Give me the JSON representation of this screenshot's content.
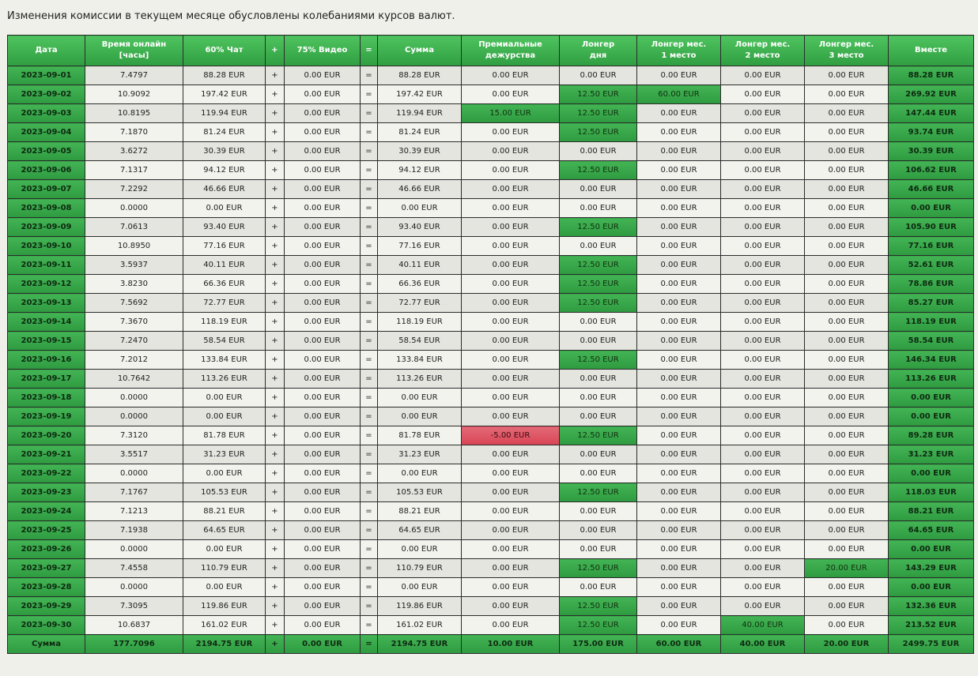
{
  "notice": "Изменения комиссии в текущем месяце обусловлены колебаниями курсов валют.",
  "colors": {
    "header_green": "#3bb34c",
    "cell_green": "#2f9e41",
    "cell_red": "#d94455",
    "row_light": "#f3f3ee",
    "row_dark": "#e4e5df"
  },
  "headers": {
    "date": "Дата",
    "hours_line1": "Время онлайн",
    "hours_line2": "[часы]",
    "chat": "60% Чат",
    "plus": "+",
    "video": "75% Видео",
    "equals": "=",
    "sum": "Сумма",
    "premium_line1": "Премиальные",
    "premium_line2": "дежурства",
    "longer_day_line1": "Лонгер",
    "longer_day_line2": "дня",
    "longer_m1_line1": "Лонгер мес.",
    "longer_m1_line2": "1 место",
    "longer_m2_line1": "Лонгер мес.",
    "longer_m2_line2": "2 место",
    "longer_m3_line1": "Лонгер мес.",
    "longer_m3_line2": "3 место",
    "total": "Вместе"
  },
  "rows": [
    {
      "date": "2023-09-01",
      "hours": "7.4797",
      "chat": "88.28 EUR",
      "plus": "+",
      "video": "0.00 EUR",
      "eq": "=",
      "sum": "88.28 EUR",
      "premium": "0.00 EUR",
      "longer_day": "0.00 EUR",
      "m1": "0.00 EUR",
      "m2": "0.00 EUR",
      "m3": "0.00 EUR",
      "total": "88.28 EUR"
    },
    {
      "date": "2023-09-02",
      "hours": "10.9092",
      "chat": "197.42 EUR",
      "plus": "+",
      "video": "0.00 EUR",
      "eq": "=",
      "sum": "197.42 EUR",
      "premium": "0.00 EUR",
      "longer_day": "12.50 EUR",
      "m1": "60.00 EUR",
      "m2": "0.00 EUR",
      "m3": "0.00 EUR",
      "total": "269.92 EUR"
    },
    {
      "date": "2023-09-03",
      "hours": "10.8195",
      "chat": "119.94 EUR",
      "plus": "+",
      "video": "0.00 EUR",
      "eq": "=",
      "sum": "119.94 EUR",
      "premium": "15.00 EUR",
      "longer_day": "12.50 EUR",
      "m1": "0.00 EUR",
      "m2": "0.00 EUR",
      "m3": "0.00 EUR",
      "total": "147.44 EUR"
    },
    {
      "date": "2023-09-04",
      "hours": "7.1870",
      "chat": "81.24 EUR",
      "plus": "+",
      "video": "0.00 EUR",
      "eq": "=",
      "sum": "81.24 EUR",
      "premium": "0.00 EUR",
      "longer_day": "12.50 EUR",
      "m1": "0.00 EUR",
      "m2": "0.00 EUR",
      "m3": "0.00 EUR",
      "total": "93.74 EUR"
    },
    {
      "date": "2023-09-05",
      "hours": "3.6272",
      "chat": "30.39 EUR",
      "plus": "+",
      "video": "0.00 EUR",
      "eq": "=",
      "sum": "30.39 EUR",
      "premium": "0.00 EUR",
      "longer_day": "0.00 EUR",
      "m1": "0.00 EUR",
      "m2": "0.00 EUR",
      "m3": "0.00 EUR",
      "total": "30.39 EUR"
    },
    {
      "date": "2023-09-06",
      "hours": "7.1317",
      "chat": "94.12 EUR",
      "plus": "+",
      "video": "0.00 EUR",
      "eq": "=",
      "sum": "94.12 EUR",
      "premium": "0.00 EUR",
      "longer_day": "12.50 EUR",
      "m1": "0.00 EUR",
      "m2": "0.00 EUR",
      "m3": "0.00 EUR",
      "total": "106.62 EUR"
    },
    {
      "date": "2023-09-07",
      "hours": "7.2292",
      "chat": "46.66 EUR",
      "plus": "+",
      "video": "0.00 EUR",
      "eq": "=",
      "sum": "46.66 EUR",
      "premium": "0.00 EUR",
      "longer_day": "0.00 EUR",
      "m1": "0.00 EUR",
      "m2": "0.00 EUR",
      "m3": "0.00 EUR",
      "total": "46.66 EUR"
    },
    {
      "date": "2023-09-08",
      "hours": "0.0000",
      "chat": "0.00 EUR",
      "plus": "+",
      "video": "0.00 EUR",
      "eq": "=",
      "sum": "0.00 EUR",
      "premium": "0.00 EUR",
      "longer_day": "0.00 EUR",
      "m1": "0.00 EUR",
      "m2": "0.00 EUR",
      "m3": "0.00 EUR",
      "total": "0.00 EUR"
    },
    {
      "date": "2023-09-09",
      "hours": "7.0613",
      "chat": "93.40 EUR",
      "plus": "+",
      "video": "0.00 EUR",
      "eq": "=",
      "sum": "93.40 EUR",
      "premium": "0.00 EUR",
      "longer_day": "12.50 EUR",
      "m1": "0.00 EUR",
      "m2": "0.00 EUR",
      "m3": "0.00 EUR",
      "total": "105.90 EUR"
    },
    {
      "date": "2023-09-10",
      "hours": "10.8950",
      "chat": "77.16 EUR",
      "plus": "+",
      "video": "0.00 EUR",
      "eq": "=",
      "sum": "77.16 EUR",
      "premium": "0.00 EUR",
      "longer_day": "0.00 EUR",
      "m1": "0.00 EUR",
      "m2": "0.00 EUR",
      "m3": "0.00 EUR",
      "total": "77.16 EUR"
    },
    {
      "date": "2023-09-11",
      "hours": "3.5937",
      "chat": "40.11 EUR",
      "plus": "+",
      "video": "0.00 EUR",
      "eq": "=",
      "sum": "40.11 EUR",
      "premium": "0.00 EUR",
      "longer_day": "12.50 EUR",
      "m1": "0.00 EUR",
      "m2": "0.00 EUR",
      "m3": "0.00 EUR",
      "total": "52.61 EUR"
    },
    {
      "date": "2023-09-12",
      "hours": "3.8230",
      "chat": "66.36 EUR",
      "plus": "+",
      "video": "0.00 EUR",
      "eq": "=",
      "sum": "66.36 EUR",
      "premium": "0.00 EUR",
      "longer_day": "12.50 EUR",
      "m1": "0.00 EUR",
      "m2": "0.00 EUR",
      "m3": "0.00 EUR",
      "total": "78.86 EUR"
    },
    {
      "date": "2023-09-13",
      "hours": "7.5692",
      "chat": "72.77 EUR",
      "plus": "+",
      "video": "0.00 EUR",
      "eq": "=",
      "sum": "72.77 EUR",
      "premium": "0.00 EUR",
      "longer_day": "12.50 EUR",
      "m1": "0.00 EUR",
      "m2": "0.00 EUR",
      "m3": "0.00 EUR",
      "total": "85.27 EUR"
    },
    {
      "date": "2023-09-14",
      "hours": "7.3670",
      "chat": "118.19 EUR",
      "plus": "+",
      "video": "0.00 EUR",
      "eq": "=",
      "sum": "118.19 EUR",
      "premium": "0.00 EUR",
      "longer_day": "0.00 EUR",
      "m1": "0.00 EUR",
      "m2": "0.00 EUR",
      "m3": "0.00 EUR",
      "total": "118.19 EUR"
    },
    {
      "date": "2023-09-15",
      "hours": "7.2470",
      "chat": "58.54 EUR",
      "plus": "+",
      "video": "0.00 EUR",
      "eq": "=",
      "sum": "58.54 EUR",
      "premium": "0.00 EUR",
      "longer_day": "0.00 EUR",
      "m1": "0.00 EUR",
      "m2": "0.00 EUR",
      "m3": "0.00 EUR",
      "total": "58.54 EUR"
    },
    {
      "date": "2023-09-16",
      "hours": "7.2012",
      "chat": "133.84 EUR",
      "plus": "+",
      "video": "0.00 EUR",
      "eq": "=",
      "sum": "133.84 EUR",
      "premium": "0.00 EUR",
      "longer_day": "12.50 EUR",
      "m1": "0.00 EUR",
      "m2": "0.00 EUR",
      "m3": "0.00 EUR",
      "total": "146.34 EUR"
    },
    {
      "date": "2023-09-17",
      "hours": "10.7642",
      "chat": "113.26 EUR",
      "plus": "+",
      "video": "0.00 EUR",
      "eq": "=",
      "sum": "113.26 EUR",
      "premium": "0.00 EUR",
      "longer_day": "0.00 EUR",
      "m1": "0.00 EUR",
      "m2": "0.00 EUR",
      "m3": "0.00 EUR",
      "total": "113.26 EUR"
    },
    {
      "date": "2023-09-18",
      "hours": "0.0000",
      "chat": "0.00 EUR",
      "plus": "+",
      "video": "0.00 EUR",
      "eq": "=",
      "sum": "0.00 EUR",
      "premium": "0.00 EUR",
      "longer_day": "0.00 EUR",
      "m1": "0.00 EUR",
      "m2": "0.00 EUR",
      "m3": "0.00 EUR",
      "total": "0.00 EUR"
    },
    {
      "date": "2023-09-19",
      "hours": "0.0000",
      "chat": "0.00 EUR",
      "plus": "+",
      "video": "0.00 EUR",
      "eq": "=",
      "sum": "0.00 EUR",
      "premium": "0.00 EUR",
      "longer_day": "0.00 EUR",
      "m1": "0.00 EUR",
      "m2": "0.00 EUR",
      "m3": "0.00 EUR",
      "total": "0.00 EUR"
    },
    {
      "date": "2023-09-20",
      "hours": "7.3120",
      "chat": "81.78 EUR",
      "plus": "+",
      "video": "0.00 EUR",
      "eq": "=",
      "sum": "81.78 EUR",
      "premium": "-5.00 EUR",
      "longer_day": "12.50 EUR",
      "m1": "0.00 EUR",
      "m2": "0.00 EUR",
      "m3": "0.00 EUR",
      "total": "89.28 EUR"
    },
    {
      "date": "2023-09-21",
      "hours": "3.5517",
      "chat": "31.23 EUR",
      "plus": "+",
      "video": "0.00 EUR",
      "eq": "=",
      "sum": "31.23 EUR",
      "premium": "0.00 EUR",
      "longer_day": "0.00 EUR",
      "m1": "0.00 EUR",
      "m2": "0.00 EUR",
      "m3": "0.00 EUR",
      "total": "31.23 EUR"
    },
    {
      "date": "2023-09-22",
      "hours": "0.0000",
      "chat": "0.00 EUR",
      "plus": "+",
      "video": "0.00 EUR",
      "eq": "=",
      "sum": "0.00 EUR",
      "premium": "0.00 EUR",
      "longer_day": "0.00 EUR",
      "m1": "0.00 EUR",
      "m2": "0.00 EUR",
      "m3": "0.00 EUR",
      "total": "0.00 EUR"
    },
    {
      "date": "2023-09-23",
      "hours": "7.1767",
      "chat": "105.53 EUR",
      "plus": "+",
      "video": "0.00 EUR",
      "eq": "=",
      "sum": "105.53 EUR",
      "premium": "0.00 EUR",
      "longer_day": "12.50 EUR",
      "m1": "0.00 EUR",
      "m2": "0.00 EUR",
      "m3": "0.00 EUR",
      "total": "118.03 EUR"
    },
    {
      "date": "2023-09-24",
      "hours": "7.1213",
      "chat": "88.21 EUR",
      "plus": "+",
      "video": "0.00 EUR",
      "eq": "=",
      "sum": "88.21 EUR",
      "premium": "0.00 EUR",
      "longer_day": "0.00 EUR",
      "m1": "0.00 EUR",
      "m2": "0.00 EUR",
      "m3": "0.00 EUR",
      "total": "88.21 EUR"
    },
    {
      "date": "2023-09-25",
      "hours": "7.1938",
      "chat": "64.65 EUR",
      "plus": "+",
      "video": "0.00 EUR",
      "eq": "=",
      "sum": "64.65 EUR",
      "premium": "0.00 EUR",
      "longer_day": "0.00 EUR",
      "m1": "0.00 EUR",
      "m2": "0.00 EUR",
      "m3": "0.00 EUR",
      "total": "64.65 EUR"
    },
    {
      "date": "2023-09-26",
      "hours": "0.0000",
      "chat": "0.00 EUR",
      "plus": "+",
      "video": "0.00 EUR",
      "eq": "=",
      "sum": "0.00 EUR",
      "premium": "0.00 EUR",
      "longer_day": "0.00 EUR",
      "m1": "0.00 EUR",
      "m2": "0.00 EUR",
      "m3": "0.00 EUR",
      "total": "0.00 EUR"
    },
    {
      "date": "2023-09-27",
      "hours": "7.4558",
      "chat": "110.79 EUR",
      "plus": "+",
      "video": "0.00 EUR",
      "eq": "=",
      "sum": "110.79 EUR",
      "premium": "0.00 EUR",
      "longer_day": "12.50 EUR",
      "m1": "0.00 EUR",
      "m2": "0.00 EUR",
      "m3": "20.00 EUR",
      "total": "143.29 EUR"
    },
    {
      "date": "2023-09-28",
      "hours": "0.0000",
      "chat": "0.00 EUR",
      "plus": "+",
      "video": "0.00 EUR",
      "eq": "=",
      "sum": "0.00 EUR",
      "premium": "0.00 EUR",
      "longer_day": "0.00 EUR",
      "m1": "0.00 EUR",
      "m2": "0.00 EUR",
      "m3": "0.00 EUR",
      "total": "0.00 EUR"
    },
    {
      "date": "2023-09-29",
      "hours": "7.3095",
      "chat": "119.86 EUR",
      "plus": "+",
      "video": "0.00 EUR",
      "eq": "=",
      "sum": "119.86 EUR",
      "premium": "0.00 EUR",
      "longer_day": "12.50 EUR",
      "m1": "0.00 EUR",
      "m2": "0.00 EUR",
      "m3": "0.00 EUR",
      "total": "132.36 EUR"
    },
    {
      "date": "2023-09-30",
      "hours": "10.6837",
      "chat": "161.02 EUR",
      "plus": "+",
      "video": "0.00 EUR",
      "eq": "=",
      "sum": "161.02 EUR",
      "premium": "0.00 EUR",
      "longer_day": "12.50 EUR",
      "m1": "0.00 EUR",
      "m2": "40.00 EUR",
      "m3": "0.00 EUR",
      "total": "213.52 EUR"
    }
  ],
  "summary": {
    "label": "Сумма",
    "hours": "177.7096",
    "chat": "2194.75 EUR",
    "plus": "+",
    "video": "0.00 EUR",
    "eq": "=",
    "sum": "2194.75 EUR",
    "premium": "10.00 EUR",
    "longer_day": "175.00 EUR",
    "m1": "60.00 EUR",
    "m2": "40.00 EUR",
    "m3": "20.00 EUR",
    "total": "2499.75 EUR"
  }
}
